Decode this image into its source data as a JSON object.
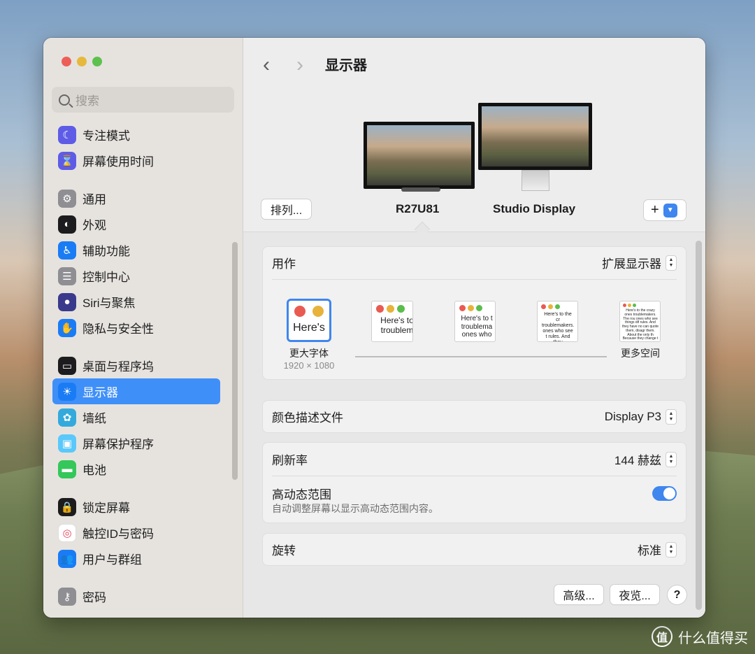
{
  "sidebar": {
    "search_placeholder": "搜索",
    "items": [
      {
        "label": "专注模式",
        "icon": "moon-icon",
        "color": "#5e5ce6",
        "glyph": "☾",
        "gap_before": false
      },
      {
        "label": "屏幕使用时间",
        "icon": "hourglass-icon",
        "color": "#5e5ce6",
        "glyph": "⌛",
        "gap_before": false
      },
      {
        "label": "通用",
        "icon": "gear-icon",
        "color": "#8e8e93",
        "glyph": "⚙",
        "gap_before": true
      },
      {
        "label": "外观",
        "icon": "appearance-icon",
        "color": "#1c1c1e",
        "glyph": "◐",
        "gap_before": false
      },
      {
        "label": "辅助功能",
        "icon": "accessibility-icon",
        "color": "#1a7cf5",
        "glyph": "♿",
        "gap_before": false
      },
      {
        "label": "控制中心",
        "icon": "toggles-icon",
        "color": "#8e8e93",
        "glyph": "☰",
        "gap_before": false
      },
      {
        "label": "Siri与聚焦",
        "icon": "siri-icon",
        "color": "#3a3a8c",
        "glyph": "●",
        "gap_before": false
      },
      {
        "label": "隐私与安全性",
        "icon": "hand-icon",
        "color": "#1a7cf5",
        "glyph": "✋",
        "gap_before": false
      },
      {
        "label": "桌面与程序坞",
        "icon": "dock-icon",
        "color": "#1c1c1e",
        "glyph": "▭",
        "gap_before": true
      },
      {
        "label": "显示器",
        "icon": "sun-icon",
        "color": "#1a7cf5",
        "glyph": "☀",
        "gap_before": false,
        "active": true
      },
      {
        "label": "墙纸",
        "icon": "flower-icon",
        "color": "#34aadc",
        "glyph": "✿",
        "gap_before": false
      },
      {
        "label": "屏幕保护程序",
        "icon": "screensaver-icon",
        "color": "#5ac8fa",
        "glyph": "▣",
        "gap_before": false
      },
      {
        "label": "电池",
        "icon": "battery-icon",
        "color": "#34c759",
        "glyph": "▬",
        "gap_before": false
      },
      {
        "label": "锁定屏幕",
        "icon": "lock-icon",
        "color": "#1c1c1e",
        "glyph": "🔒",
        "gap_before": true
      },
      {
        "label": "触控ID与密码",
        "icon": "fingerprint-icon",
        "color": "#ffffff",
        "glyph": "◎",
        "gap_before": false
      },
      {
        "label": "用户与群组",
        "icon": "users-icon",
        "color": "#1a7cf5",
        "glyph": "👥",
        "gap_before": false
      },
      {
        "label": "密码",
        "icon": "key-icon",
        "color": "#8e8e93",
        "glyph": "⚷",
        "gap_before": true
      }
    ]
  },
  "header": {
    "title": "显示器",
    "arrange_label": "排列...",
    "add_label": "+",
    "monitors": [
      {
        "name": "R27U81",
        "selected": true
      },
      {
        "name": "Studio Display",
        "selected": false
      }
    ]
  },
  "use_as": {
    "label": "用作",
    "value": "扩展显示器",
    "resolutions": [
      {
        "preview": "Here's",
        "label": "更大字体",
        "sub": "1920 × 1080"
      },
      {
        "preview": "Here's to troublem",
        "label": "",
        "sub": ""
      },
      {
        "preview": "Here's to t troublema ones who",
        "label": "",
        "sub": ""
      },
      {
        "preview": "Here's to the cr troublemakers. ones who see t rules. And they",
        "label": "",
        "sub": ""
      },
      {
        "preview": "Here's to the crazy ones troublemakers. The rou ones who see things dif rules. And they have no can quote them, disagr them. About the only th Because they change t",
        "label": "更多空间",
        "sub": ""
      }
    ]
  },
  "color_profile": {
    "label": "颜色描述文件",
    "value": "Display P3"
  },
  "refresh": {
    "label": "刷新率",
    "value": "144 赫兹"
  },
  "hdr": {
    "label": "高动态范围",
    "description": "自动调整屏幕以显示高动态范围内容。",
    "enabled": true
  },
  "rotation": {
    "label": "旋转",
    "value": "标准"
  },
  "footer": {
    "advanced_label": "高级...",
    "night_shift_label": "夜览...",
    "help_label": "?"
  },
  "watermark": {
    "text": "什么值得买",
    "logo": "值"
  },
  "colors": {
    "accent": "#3f86ef",
    "selection": "#3f8ff8"
  }
}
